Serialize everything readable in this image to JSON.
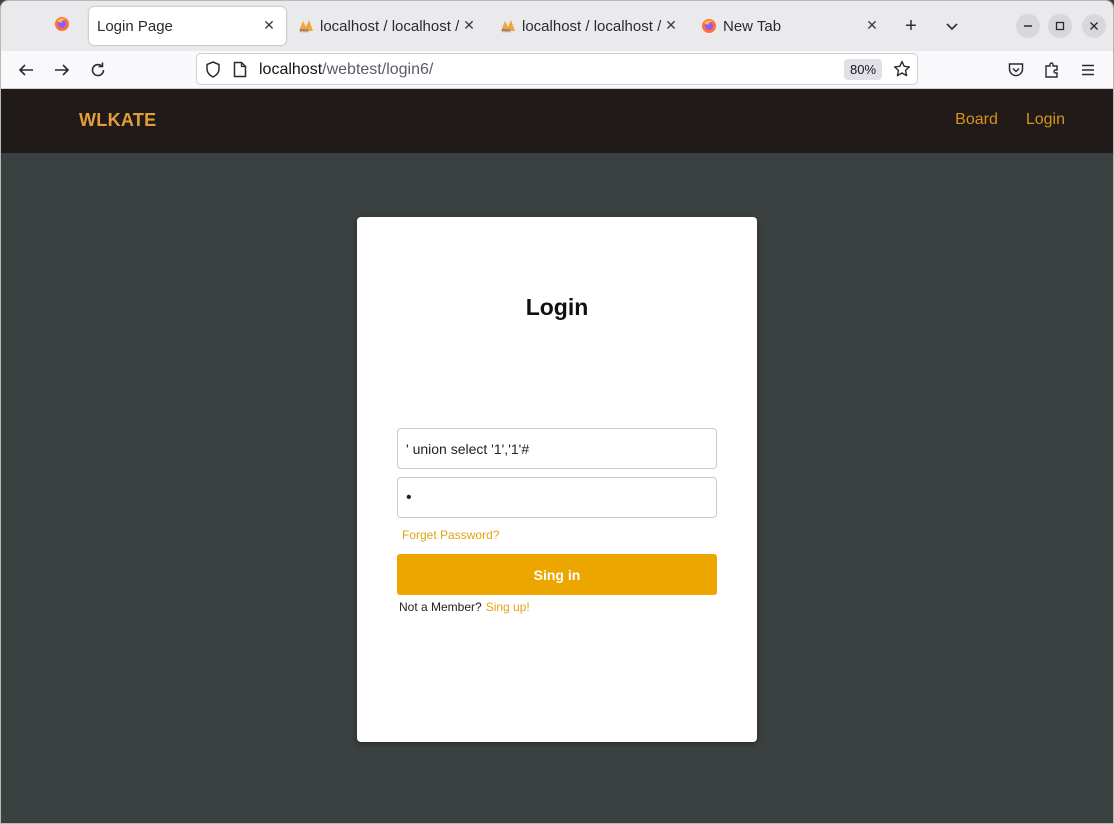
{
  "browser": {
    "tabs": [
      {
        "label": "Login Page",
        "icon": "firefox-icon",
        "active": true
      },
      {
        "label": "localhost / localhost / ",
        "icon": "phpmyadmin-icon",
        "active": false
      },
      {
        "label": "localhost / localhost / ",
        "icon": "phpmyadmin-icon",
        "active": false
      },
      {
        "label": "New Tab",
        "icon": "firefox-icon",
        "active": false
      }
    ],
    "url_host": "localhost",
    "url_path": "/webtest/login6/",
    "zoom": "80%"
  },
  "site": {
    "brand": "WLKATE",
    "nav": [
      {
        "label": "Board"
      },
      {
        "label": "Login"
      }
    ]
  },
  "login": {
    "title": "Login",
    "username_value": "' union select '1','1'#",
    "password_mask": "•",
    "forgot": "Forget Password?",
    "submit": "Sing in",
    "member_text": "Not a Member?",
    "signup": "Sing up!"
  },
  "colors": {
    "header_bg": "#201b18",
    "brand": "#e49d3b",
    "nav_link": "#d8921d",
    "page_bg": "#3b4041",
    "accent": "#eda500"
  }
}
